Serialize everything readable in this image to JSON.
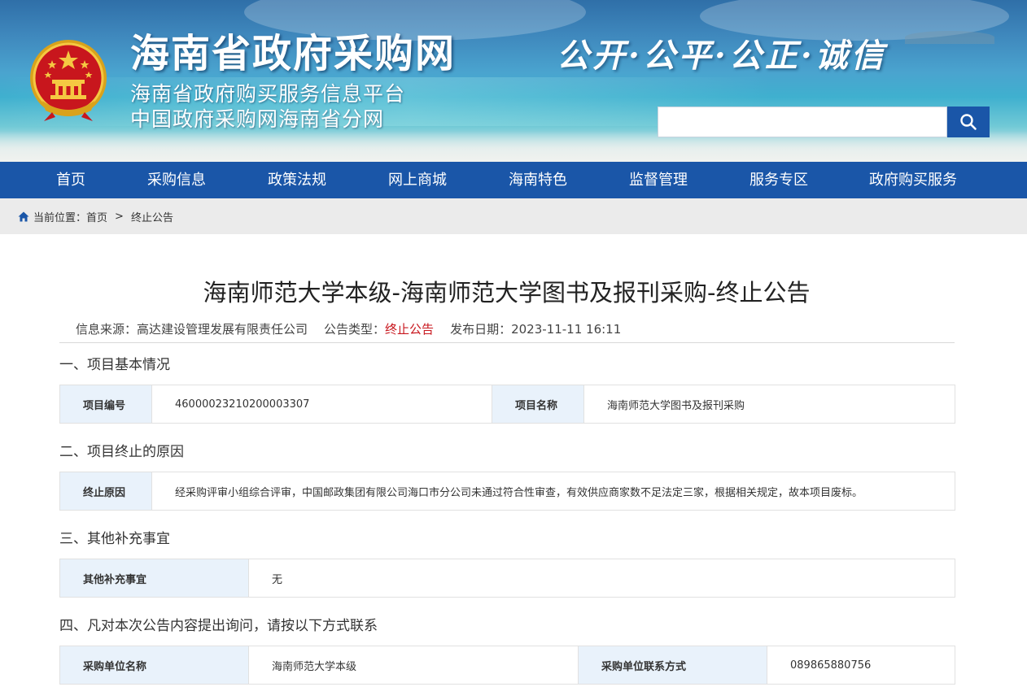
{
  "header": {
    "site_title": "海南省政府采购网",
    "subtitle_1": "海南省政府购买服务信息平台",
    "subtitle_2": "中国政府采购网海南省分网",
    "slogan": "公开·公平·公正·诚信",
    "search": {
      "value": "",
      "placeholder": ""
    }
  },
  "nav": {
    "items": [
      "首页",
      "采购信息",
      "政策法规",
      "网上商城",
      "海南特色",
      "监督管理",
      "服务专区",
      "政府购买服务"
    ]
  },
  "breadcrumb": {
    "prefix": "当前位置：",
    "home": "首页",
    "separator": ">",
    "current": "终止公告"
  },
  "article": {
    "title": "海南师范大学本级-海南师范大学图书及报刊采购-终止公告",
    "meta": {
      "source_label": "信息来源：",
      "source_value": "高达建设管理发展有限责任公司",
      "type_label": "公告类型：",
      "type_value": "终止公告",
      "date_label": "发布日期：",
      "date_value": "2023-11-11 16:11"
    },
    "sections": [
      {
        "heading": "一、项目基本情况",
        "rows": [
          {
            "label1": "项目编号",
            "value1": "46000023210200003307",
            "label2": "项目名称",
            "value2": "海南师范大学图书及报刊采购"
          }
        ]
      },
      {
        "heading": "二、项目终止的原因",
        "rows": [
          {
            "label1": "终止原因",
            "value1": "经采购评审小组综合评审，中国邮政集团有限公司海口市分公司未通过符合性审查，有效供应商家数不足法定三家，根据相关规定，故本项目废标。"
          }
        ]
      },
      {
        "heading": "三、其他补充事宜",
        "rows": [
          {
            "label1": "其他补充事宜",
            "value1": "无"
          }
        ]
      },
      {
        "heading": "四、凡对本次公告内容提出询问，请按以下方式联系",
        "rows": [
          {
            "label1": "采购单位名称",
            "value1": "海南师范大学本级",
            "label2": "采购单位联系方式",
            "value2": "089865880756"
          }
        ]
      }
    ]
  },
  "colors": {
    "nav_bg": "#1a56a8",
    "breadcrumb_bg": "#ebebeb",
    "label_cell_bg": "#e9f2fb",
    "accent_red": "#c8161d"
  },
  "icons": {
    "emblem": "national-emblem-icon",
    "search": "search-icon",
    "home": "home-icon"
  }
}
